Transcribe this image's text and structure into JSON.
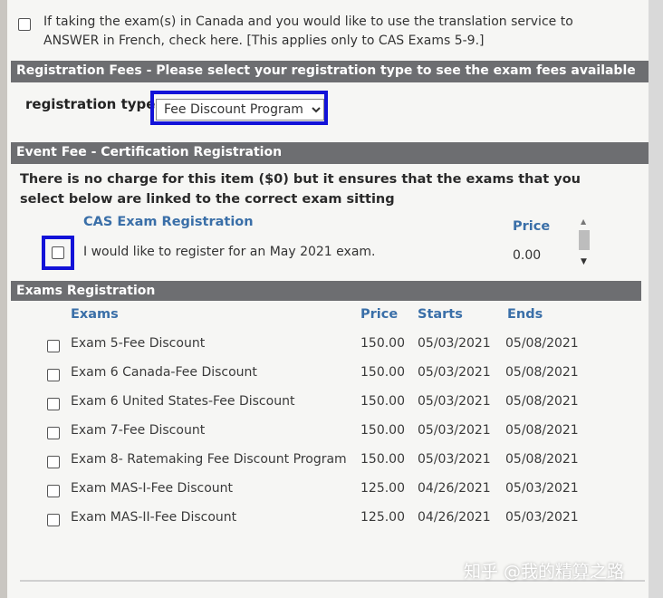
{
  "translation": {
    "text": "If taking the exam(s) in Canada and you would like to use the translation service to ANSWER in French, check here. [This applies only to CAS Exams 5-9.]"
  },
  "registration_fees": {
    "header": "Registration Fees - Please select your registration type to see the exam fees available",
    "label": "registration type:",
    "selected": "Fee Discount Program"
  },
  "event_fee": {
    "header": "Event Fee - Certification Registration",
    "description": "There is no charge for this item ($0) but it ensures that the exams that you select below are linked to the correct exam sitting",
    "col_name": "CAS Exam Registration",
    "col_price": "Price",
    "item_text": "I would like to register for an May 2021 exam.",
    "item_price": "0.00"
  },
  "exams": {
    "header": "Exams Registration",
    "columns": {
      "name": "Exams",
      "price": "Price",
      "starts": "Starts",
      "ends": "Ends"
    },
    "rows": [
      {
        "name": "Exam 5-Fee Discount",
        "price": "150.00",
        "starts": "05/03/2021",
        "ends": "05/08/2021"
      },
      {
        "name": "Exam 6 Canada-Fee Discount",
        "price": "150.00",
        "starts": "05/03/2021",
        "ends": "05/08/2021"
      },
      {
        "name": "Exam 6 United States-Fee Discount",
        "price": "150.00",
        "starts": "05/03/2021",
        "ends": "05/08/2021"
      },
      {
        "name": "Exam 7-Fee Discount",
        "price": "150.00",
        "starts": "05/03/2021",
        "ends": "05/08/2021"
      },
      {
        "name": "Exam 8- Ratemaking Fee Discount Program",
        "price": "150.00",
        "starts": "05/03/2021",
        "ends": "05/08/2021"
      },
      {
        "name": "Exam MAS-I-Fee Discount",
        "price": "125.00",
        "starts": "04/26/2021",
        "ends": "05/03/2021"
      },
      {
        "name": "Exam MAS-II-Fee Discount",
        "price": "125.00",
        "starts": "04/26/2021",
        "ends": "05/03/2021"
      }
    ]
  },
  "watermark": "知乎 @我的精算之路",
  "colors": {
    "section_bar": "#6d6e71",
    "highlight": "#1212d8",
    "column_header": "#3a6fa8"
  }
}
